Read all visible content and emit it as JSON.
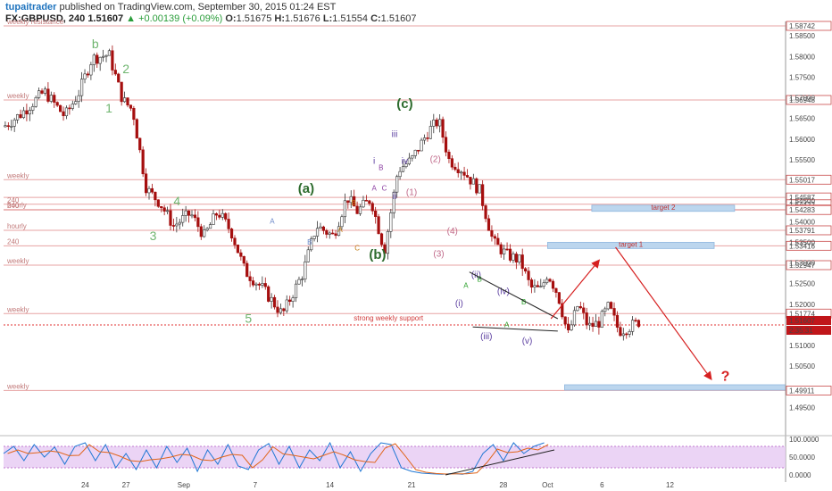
{
  "header": {
    "author": "tupaitrader",
    "published": "published on TradingView.com, September 30, 2015 01:24 EST",
    "symbol": "FX:GBPUSD, 240",
    "last": "1.51607",
    "change": "▲ +0.00139 (+0.09%)",
    "o_label": "O:",
    "o": "1.51675",
    "h_label": "H:",
    "h": "1.51676",
    "l_label": "L:",
    "l": "1.51554",
    "c_label": "C:",
    "c": "1.51607"
  },
  "colors": {
    "up": "#333333",
    "down": "#a50e0e",
    "level": "#e7a3a3",
    "wave_green": "#2d6b2d",
    "wave_light": "#6fb56f",
    "wave_purple": "#6a3fa0",
    "target_box": "#bcd6ee",
    "arrow": "#d62020"
  },
  "chart_data": {
    "type": "candlestick",
    "symbol": "FX:GBPUSD",
    "interval": "240",
    "ylim": [
      1.4925,
      1.5885
    ],
    "yticks": [
      1.585,
      1.58,
      1.575,
      1.57,
      1.565,
      1.56,
      1.555,
      1.545,
      1.54,
      1.535,
      1.53,
      1.525,
      1.52,
      1.51,
      1.505,
      1.495
    ],
    "x_ticks": [
      "24",
      "27",
      "Sep",
      "7",
      "14",
      "21",
      "28",
      "Oct",
      "6",
      "12"
    ],
    "price_path": [
      [
        0,
        1.563
      ],
      [
        5,
        1.566
      ],
      [
        12,
        1.5715
      ],
      [
        18,
        1.5655
      ],
      [
        22,
        1.571
      ],
      [
        26,
        1.5795
      ],
      [
        31,
        1.5805
      ],
      [
        35,
        1.5695
      ],
      [
        38,
        1.567
      ],
      [
        42,
        1.548
      ],
      [
        46,
        1.5445
      ],
      [
        50,
        1.539
      ],
      [
        55,
        1.542
      ],
      [
        59,
        1.5365
      ],
      [
        63,
        1.5425
      ],
      [
        67,
        1.5375
      ],
      [
        71,
        1.528
      ],
      [
        76,
        1.524
      ],
      [
        82,
        1.5175
      ],
      [
        88,
        1.5275
      ],
      [
        92,
        1.539
      ],
      [
        97,
        1.5365
      ],
      [
        101,
        1.546
      ],
      [
        104,
        1.5425
      ],
      [
        108,
        1.5455
      ],
      [
        112,
        1.533
      ],
      [
        116,
        1.5525
      ],
      [
        120,
        1.555
      ],
      [
        125,
        1.562
      ],
      [
        128,
        1.5645
      ],
      [
        131,
        1.555
      ],
      [
        135,
        1.5525
      ],
      [
        140,
        1.5475
      ],
      [
        144,
        1.535
      ],
      [
        148,
        1.532
      ],
      [
        152,
        1.5305
      ],
      [
        155,
        1.524
      ],
      [
        158,
        1.5235
      ],
      [
        160,
        1.5275
      ],
      [
        163,
        1.5225
      ],
      [
        166,
        1.5125
      ],
      [
        169,
        1.52
      ],
      [
        172,
        1.5145
      ],
      [
        175,
        1.5155
      ],
      [
        178,
        1.5195
      ],
      [
        181,
        1.5135
      ],
      [
        184,
        1.5145
      ],
      [
        187,
        1.5158
      ]
    ],
    "levels": [
      {
        "label": "weekly resistance",
        "price": 1.58742,
        "tag": "1.58742"
      },
      {
        "label": "weekly",
        "price": 1.56948,
        "tag": "1.56948"
      },
      {
        "label": "weekly",
        "price": 1.55017,
        "tag": "1.55017"
      },
      {
        "label": "",
        "price": 1.54587,
        "tag": "1.54587"
      },
      {
        "label": "240",
        "price": 1.54422,
        "tag": "1.54422"
      },
      {
        "label": "hourly",
        "price": 1.54294,
        "tag": "1.54294"
      },
      {
        "label": "240",
        "price": 1.54283,
        "tag": "1.54283"
      },
      {
        "label": "hourly",
        "price": 1.53791,
        "tag": "1.53791"
      },
      {
        "label": "240",
        "price": 1.53416,
        "tag": "1.53416"
      },
      {
        "label": "weekly",
        "price": 1.52947,
        "tag": "1.52947"
      },
      {
        "label": "weekly",
        "price": 1.51774,
        "tag": "1.51774"
      },
      {
        "label": "weekly",
        "price": 1.49911,
        "tag": "1.49911"
      }
    ],
    "last_price_tag": "1.51607",
    "countdown": "2:35:31",
    "support_label": "strong weekly support",
    "support_price": 1.5165,
    "targets": [
      {
        "label": "target 2",
        "ylo": 1.5425,
        "yhi": 1.544
      },
      {
        "label": "target 1",
        "ylo": 1.5335,
        "yhi": 1.535
      },
      {
        "label": "",
        "ylo": 1.4992,
        "yhi": 1.5005
      }
    ],
    "question_mark": "?",
    "wave_labels": [
      {
        "t": "b",
        "x": 27,
        "y": 1.582,
        "c": "light"
      },
      {
        "t": "2",
        "x": 36,
        "y": 1.576,
        "c": "light"
      },
      {
        "t": "1",
        "x": 31,
        "y": 1.5665,
        "c": "light"
      },
      {
        "t": "4",
        "x": 51,
        "y": 1.544,
        "c": "light"
      },
      {
        "t": "3",
        "x": 44,
        "y": 1.5355,
        "c": "light"
      },
      {
        "t": "5",
        "x": 72,
        "y": 1.5155,
        "c": "light"
      },
      {
        "t": "(a)",
        "x": 89,
        "y": 1.547,
        "c": "dark"
      },
      {
        "t": "(b)",
        "x": 110,
        "y": 1.531,
        "c": "dark"
      },
      {
        "t": "(c)",
        "x": 118,
        "y": 1.5675,
        "c": "dark"
      },
      {
        "t": "iii",
        "x": 115,
        "y": 1.5605,
        "c": "purple"
      },
      {
        "t": "i",
        "x": 109,
        "y": 1.554,
        "c": "purple"
      },
      {
        "t": "iv",
        "x": 118,
        "y": 1.554,
        "c": "purple"
      },
      {
        "t": "ii",
        "x": 115,
        "y": 1.5455,
        "c": "purple"
      },
      {
        "t": "(2)",
        "x": 127,
        "y": 1.5545,
        "c": "pink"
      },
      {
        "t": "(1)",
        "x": 120,
        "y": 1.5465,
        "c": "pink"
      },
      {
        "t": "(4)",
        "x": 132,
        "y": 1.537,
        "c": "pink"
      },
      {
        "t": "(3)",
        "x": 128,
        "y": 1.5315,
        "c": "pink"
      },
      {
        "t": "(ii)",
        "x": 139,
        "y": 1.5265,
        "c": "purple"
      },
      {
        "t": "(iv)",
        "x": 147,
        "y": 1.5225,
        "c": "purple"
      },
      {
        "t": "(iii)",
        "x": 142,
        "y": 1.5115,
        "c": "purple"
      },
      {
        "t": "(v)",
        "x": 154,
        "y": 1.5105,
        "c": "purple"
      },
      {
        "t": "(i)",
        "x": 134,
        "y": 1.5195,
        "c": "purple"
      }
    ],
    "small_labels": [
      {
        "t": "A",
        "x": 79,
        "y": 1.5395,
        "c": "#6b88c9"
      },
      {
        "t": "B",
        "x": 90,
        "y": 1.5345,
        "c": "#6b88c9"
      },
      {
        "t": "B",
        "x": 103,
        "y": 1.544,
        "c": "#c07a15"
      },
      {
        "t": "A",
        "x": 99,
        "y": 1.5375,
        "c": "#c07a15"
      },
      {
        "t": "C",
        "x": 104,
        "y": 1.533,
        "c": "#c07a15"
      },
      {
        "t": "B",
        "x": 111,
        "y": 1.5525,
        "c": "#8a3ca0"
      },
      {
        "t": "A",
        "x": 109,
        "y": 1.5475,
        "c": "#8a3ca0"
      },
      {
        "t": "C",
        "x": 112,
        "y": 1.5475,
        "c": "#8a3ca0"
      },
      {
        "t": "A",
        "x": 136,
        "y": 1.524,
        "c": "#2aa02a"
      },
      {
        "t": "B",
        "x": 140,
        "y": 1.5255,
        "c": "#2aa02a"
      },
      {
        "t": "A",
        "x": 148,
        "y": 1.5145,
        "c": "#2aa02a"
      },
      {
        "t": "B",
        "x": 153,
        "y": 1.52,
        "c": "#2aa02a"
      }
    ],
    "triangle": {
      "upper": [
        [
          137,
          1.5278
        ],
        [
          163,
          1.5165
        ]
      ],
      "lower": [
        [
          138,
          1.5145
        ],
        [
          163,
          1.5135
        ]
      ]
    },
    "forecast_arrows": [
      {
        "from": [
          161,
          1.5165
        ],
        "to": [
          175,
          1.5305
        ]
      },
      {
        "from": [
          180,
          1.5338
        ],
        "to": [
          208,
          1.502
        ]
      }
    ],
    "oscillator": {
      "ylim": [
        0,
        100
      ],
      "yticks": [
        "100.0000",
        "50.0000",
        "0.0000"
      ],
      "band": [
        20,
        80
      ],
      "k_path": [
        [
          0,
          60
        ],
        [
          3,
          80
        ],
        [
          6,
          40
        ],
        [
          9,
          85
        ],
        [
          12,
          50
        ],
        [
          15,
          78
        ],
        [
          18,
          30
        ],
        [
          21,
          80
        ],
        [
          24,
          90
        ],
        [
          27,
          40
        ],
        [
          30,
          85
        ],
        [
          33,
          20
        ],
        [
          36,
          60
        ],
        [
          39,
          15
        ],
        [
          42,
          70
        ],
        [
          45,
          20
        ],
        [
          48,
          80
        ],
        [
          51,
          35
        ],
        [
          54,
          75
        ],
        [
          57,
          10
        ],
        [
          60,
          70
        ],
        [
          63,
          30
        ],
        [
          66,
          85
        ],
        [
          69,
          25
        ],
        [
          72,
          15
        ],
        [
          75,
          70
        ],
        [
          78,
          88
        ],
        [
          81,
          30
        ],
        [
          84,
          80
        ],
        [
          87,
          20
        ],
        [
          90,
          70
        ],
        [
          93,
          40
        ],
        [
          96,
          90
        ],
        [
          99,
          20
        ],
        [
          102,
          65
        ],
        [
          105,
          10
        ],
        [
          108,
          60
        ],
        [
          111,
          90
        ],
        [
          114,
          85
        ],
        [
          117,
          20
        ],
        [
          120,
          10
        ],
        [
          123,
          5
        ],
        [
          126,
          3
        ],
        [
          129,
          2
        ],
        [
          132,
          4
        ],
        [
          135,
          2
        ],
        [
          138,
          10
        ],
        [
          141,
          60
        ],
        [
          144,
          85
        ],
        [
          147,
          40
        ],
        [
          150,
          90
        ],
        [
          153,
          60
        ],
        [
          156,
          80
        ],
        [
          159,
          90
        ]
      ],
      "trendline": [
        [
          130,
          0
        ],
        [
          162,
          70
        ]
      ]
    }
  }
}
